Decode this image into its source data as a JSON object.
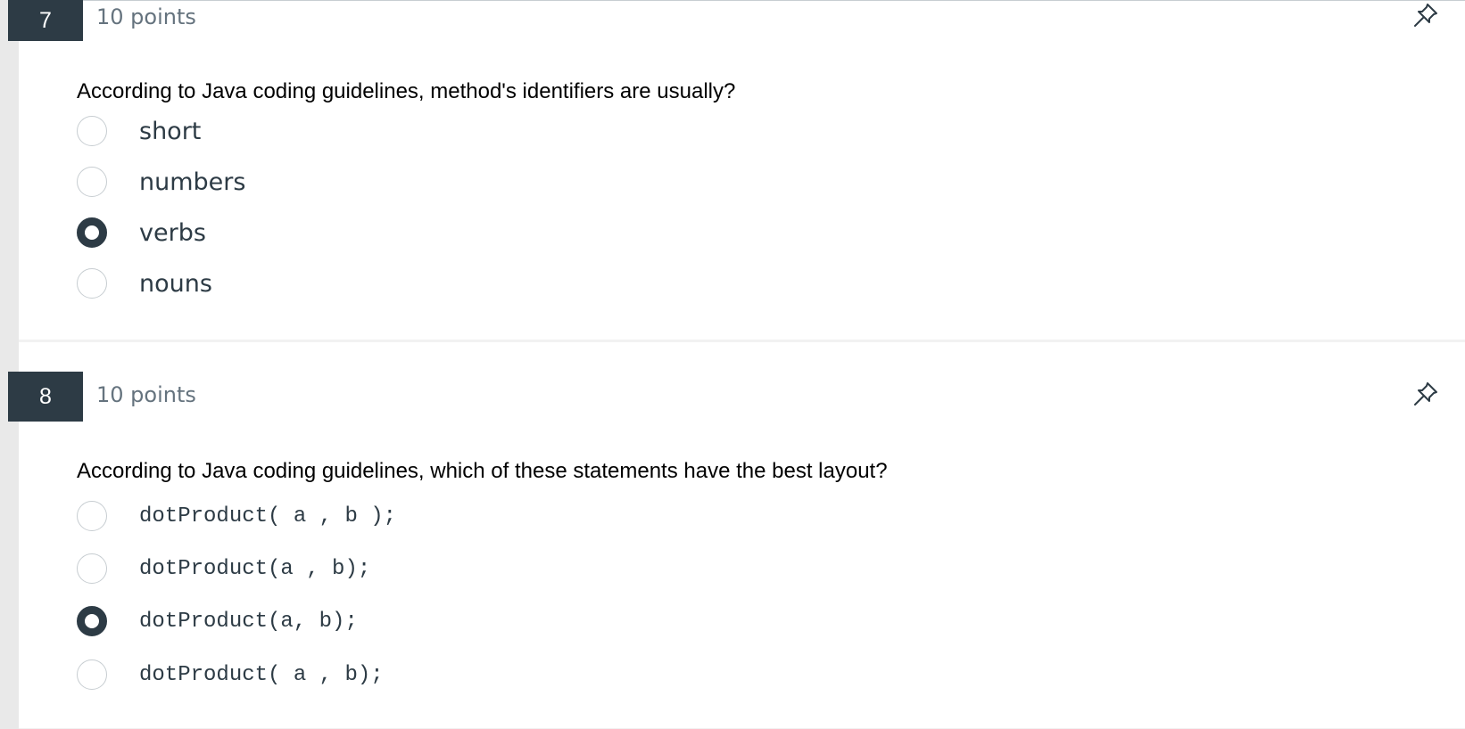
{
  "questions": [
    {
      "number": "7",
      "points": "10 points",
      "text": "According to Java coding guidelines, method's identifiers are usually?",
      "options": [
        {
          "label": "short",
          "selected": false
        },
        {
          "label": "numbers",
          "selected": false
        },
        {
          "label": "verbs",
          "selected": true
        },
        {
          "label": "nouns",
          "selected": false
        }
      ],
      "pin_icon": "pushpin-icon"
    },
    {
      "number": "8",
      "points": "10 points",
      "text": "According to Java coding guidelines, which of these statements have the best layout?",
      "options": [
        {
          "label": "dotProduct( a , b );",
          "selected": false
        },
        {
          "label": "dotProduct(a , b);",
          "selected": false
        },
        {
          "label": "dotProduct(a, b);",
          "selected": true
        },
        {
          "label": "dotProduct( a , b);",
          "selected": false
        }
      ],
      "pin_icon": "pushpin-icon"
    }
  ],
  "colors": {
    "question_number_bg": "#2d3b45",
    "points_text": "#65737e",
    "radio_checked": "#2d3b45",
    "radio_border": "#c7cdd1"
  }
}
